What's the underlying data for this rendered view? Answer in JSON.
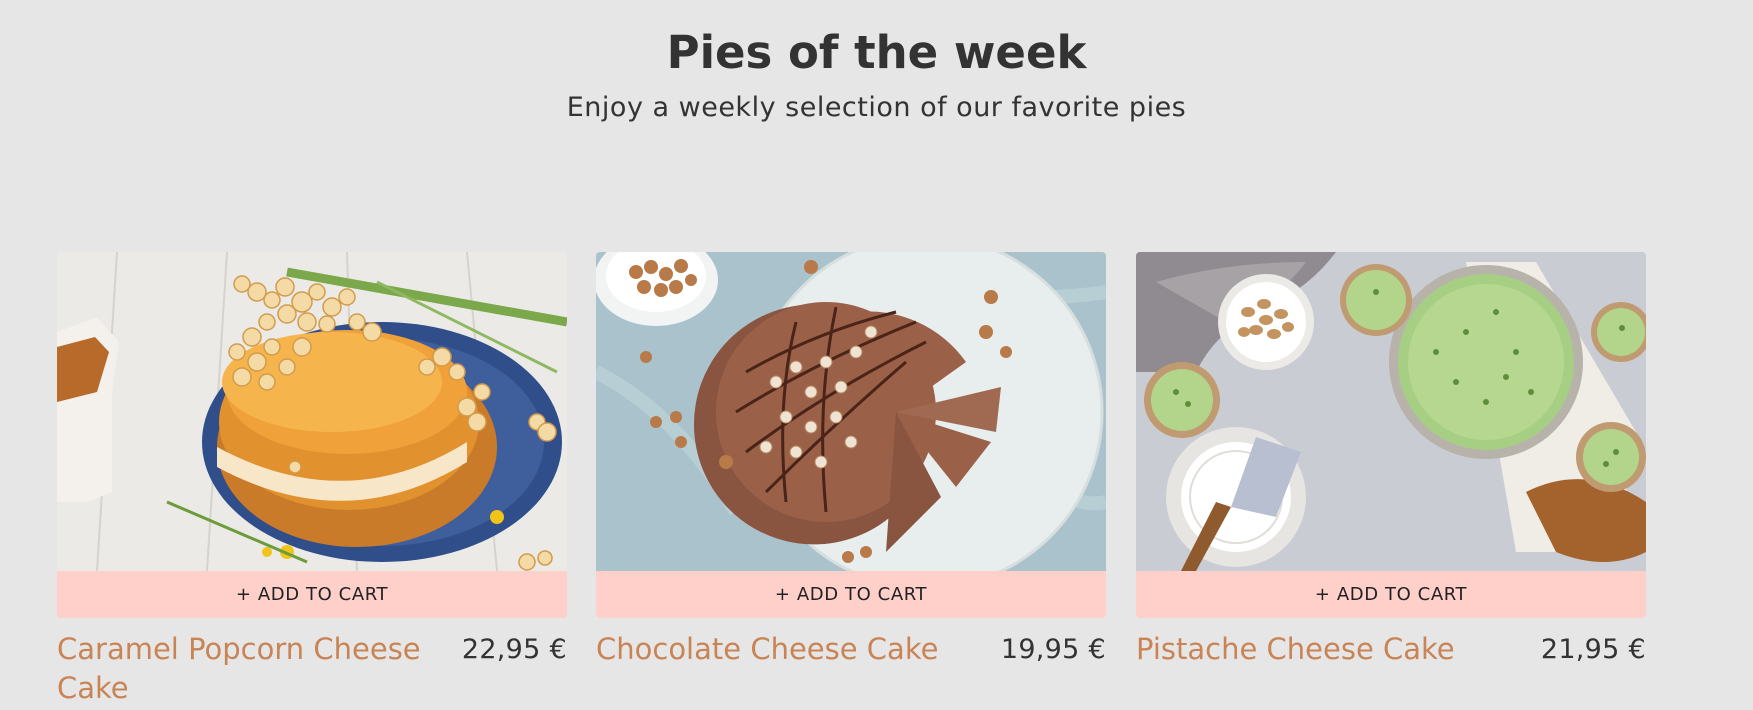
{
  "header": {
    "title": "Pies of the week",
    "subtitle": "Enjoy a weekly selection of our favorite pies"
  },
  "products": [
    {
      "name": "Caramel Popcorn Cheese Cake",
      "price": "22,95 €",
      "cart_label": "+ ADD TO CART",
      "image_alt": "Caramel popcorn cheesecake on a blue plate"
    },
    {
      "name": "Chocolate Cheese Cake",
      "price": "19,95 €",
      "cart_label": "+ ADD TO CART",
      "image_alt": "Chocolate hazelnut cheesecake on a marble board"
    },
    {
      "name": "Pistache Cheese Cake",
      "price": "21,95 €",
      "cart_label": "+ ADD TO CART",
      "image_alt": "Pistachio cheesecake with small tartlets"
    }
  ],
  "colors": {
    "background": "#e6e6e6",
    "cart_button": "#ffd0ca",
    "product_name": "#c98455",
    "text": "#333333"
  }
}
